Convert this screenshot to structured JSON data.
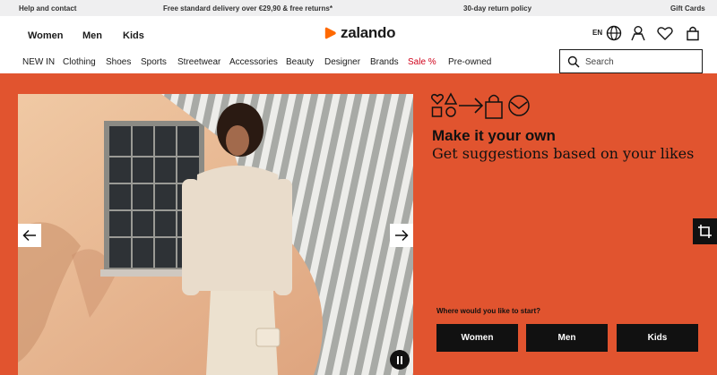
{
  "topbar": {
    "help": "Help and contact",
    "delivery": "Free standard delivery over €29,90 & free returns*",
    "returns": "30-day return policy",
    "gift": "Gift Cards"
  },
  "header": {
    "genders": [
      "Women",
      "Men",
      "Kids"
    ],
    "logo": "zalando",
    "language": "EN",
    "categories": [
      "NEW IN",
      "Clothing",
      "Shoes",
      "Sports",
      "Streetwear",
      "Accessories",
      "Beauty",
      "Designer",
      "Brands",
      "Sale %",
      "Pre-owned"
    ],
    "search_placeholder": "Search",
    "brand_color": "#ff6900",
    "sale_color": "#d0021b"
  },
  "icons": [
    "globe-icon",
    "user-icon",
    "heart-icon",
    "bag-icon",
    "search-icon",
    "arrow-left-icon",
    "arrow-right-icon",
    "pause-icon",
    "crop-icon"
  ],
  "hero": {
    "background": "#e1542f",
    "title": "Make it your own",
    "subtitle": "Get suggestions based on your likes",
    "question": "Where would you like to start?",
    "buttons": [
      "Women",
      "Men",
      "Kids"
    ]
  }
}
